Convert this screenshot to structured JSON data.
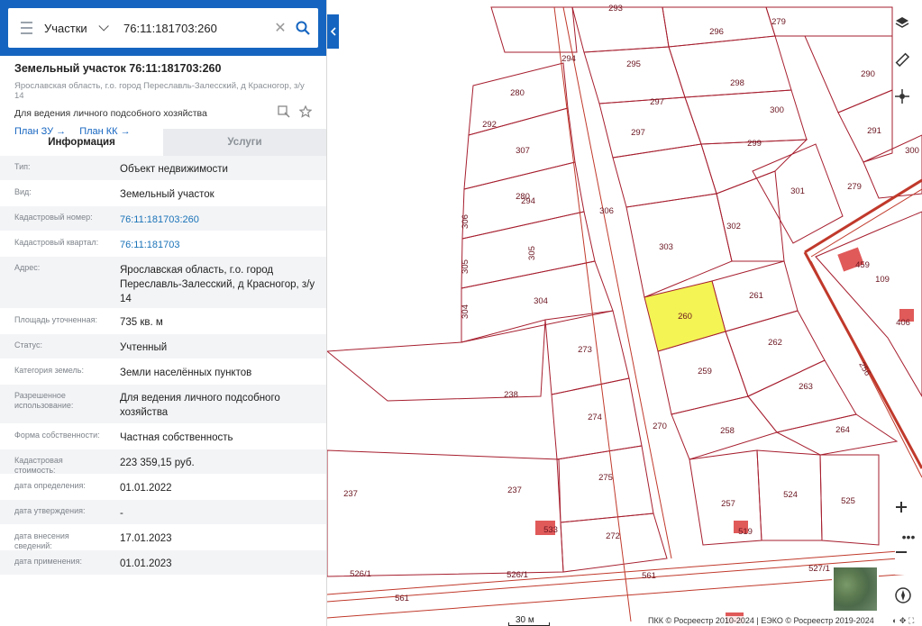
{
  "search": {
    "category": "Участки",
    "query": "76:11:181703:260"
  },
  "object": {
    "title": "Земельный участок 76:11:181703:260",
    "address_line": "Ярославская область, г.о. город Переславль-Залесский, д Красногор, з/у 14",
    "purpose": "Для ведения личного подсобного хозяйства",
    "link_plan_zu": "План ЗУ →",
    "link_plan_kk": "План КК →"
  },
  "tabs": {
    "info": "Информация",
    "services": "Услуги"
  },
  "info": [
    {
      "key": "Тип:",
      "value": "Объект недвижимости"
    },
    {
      "key": "Вид:",
      "value": "Земельный участок"
    },
    {
      "key": "Кадастровый номер:",
      "value": "76:11:181703:260"
    },
    {
      "key": "Кадастровый квартал:",
      "value": "76:11:181703"
    },
    {
      "key": "Адрес:",
      "value": "Ярославская область, г.о. город Переславль-Залесский, д Красногор, з/у 14"
    },
    {
      "key": "Площадь уточненная:",
      "value": "735 кв. м"
    },
    {
      "key": "Статус:",
      "value": "Учтенный"
    },
    {
      "key": "Категория земель:",
      "value": "Земли населённых пунктов"
    },
    {
      "key": "Разрешенное использование:",
      "value": "Для ведения личного подсобного хозяйства"
    },
    {
      "key": "Форма собственности:",
      "value": "Частная собственность"
    },
    {
      "key": "Кадастровая стоимость:",
      "value": "223 359,15 руб."
    },
    {
      "key": "дата определения:",
      "value": "01.01.2022"
    },
    {
      "key": "дата утверждения:",
      "value": "-"
    },
    {
      "key": "дата внесения сведений:",
      "value": "17.01.2023"
    },
    {
      "key": "дата применения:",
      "value": "01.01.2023"
    }
  ],
  "map": {
    "plot_labels": [
      "293",
      "279",
      "296",
      "294",
      "295",
      "298",
      "290",
      "280",
      "297",
      "300",
      "291",
      "297",
      "299",
      "300",
      "292",
      "279",
      "307",
      "280",
      "306",
      "294",
      "301",
      "302",
      "303",
      "305",
      "306",
      "109",
      "459",
      "261",
      "260",
      "304",
      "304",
      "305",
      "273",
      "262",
      "256",
      "238",
      "259",
      "263",
      "274",
      "270",
      "258",
      "264",
      "237",
      "237",
      "275",
      "257",
      "524",
      "525",
      "519",
      "533",
      "272",
      "526/1",
      "526/1",
      "561",
      "527/1",
      "561",
      "406"
    ],
    "highlight_color": "#f4f454",
    "scale": "30 м",
    "attribution": "ПКК © Росреестр 2010-2024 | ЕЭКО © Росреестр 2019-2024"
  }
}
